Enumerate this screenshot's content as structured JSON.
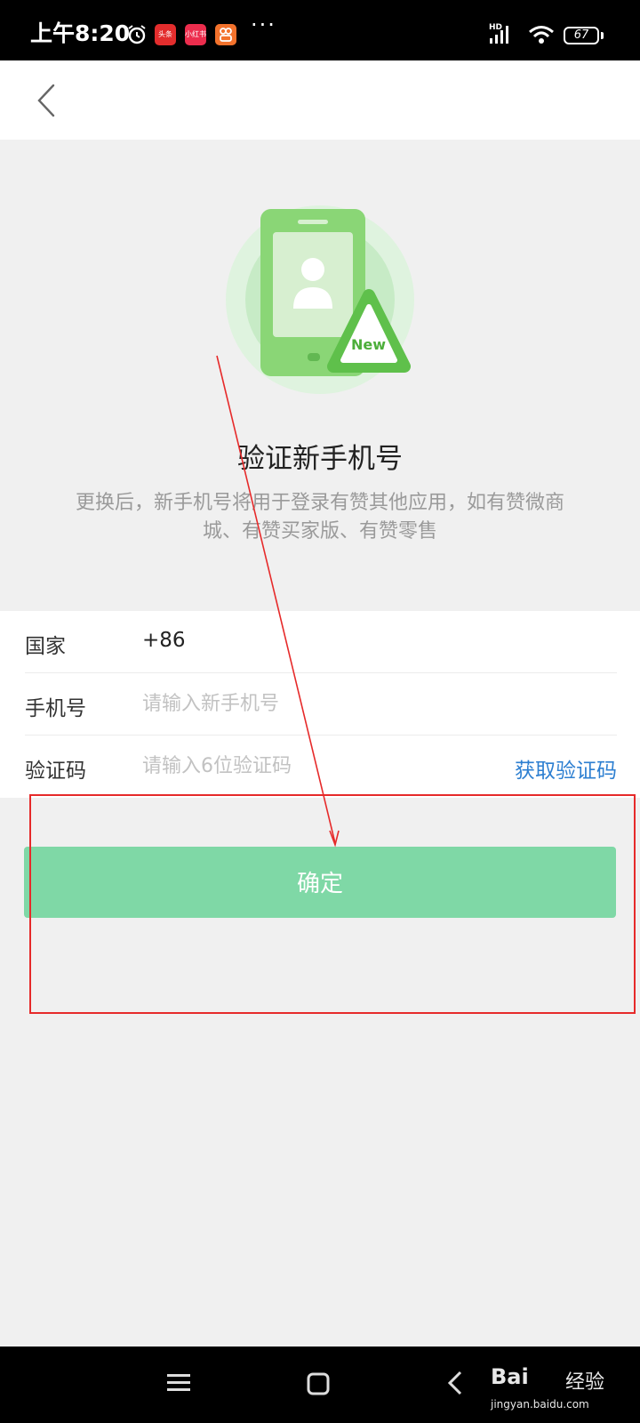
{
  "status_bar": {
    "time": "上午8:20",
    "app_badges": [
      "头条",
      "小红书",
      ""
    ],
    "more": "···",
    "network": "HD",
    "battery": "67"
  },
  "hero": {
    "badge": "New",
    "title": "验证新手机号",
    "description": "更换后，新手机号将用于登录有赞其他应用，如有赞微商城、有赞买家版、有赞零售"
  },
  "form": {
    "country": {
      "label": "国家",
      "value": "+86"
    },
    "phone": {
      "label": "手机号",
      "placeholder": "请输入新手机号"
    },
    "code": {
      "label": "验证码",
      "placeholder": "请输入6位验证码",
      "action": "获取验证码"
    }
  },
  "confirm_label": "确定",
  "watermark": {
    "brand": "Bai",
    "brand_suffix": "经验",
    "url": "jingyan.baidu.com"
  },
  "colors": {
    "accent_green": "#7fd8a6",
    "link_blue": "#2d7fd1",
    "annotation_red": "#e62a2a"
  }
}
